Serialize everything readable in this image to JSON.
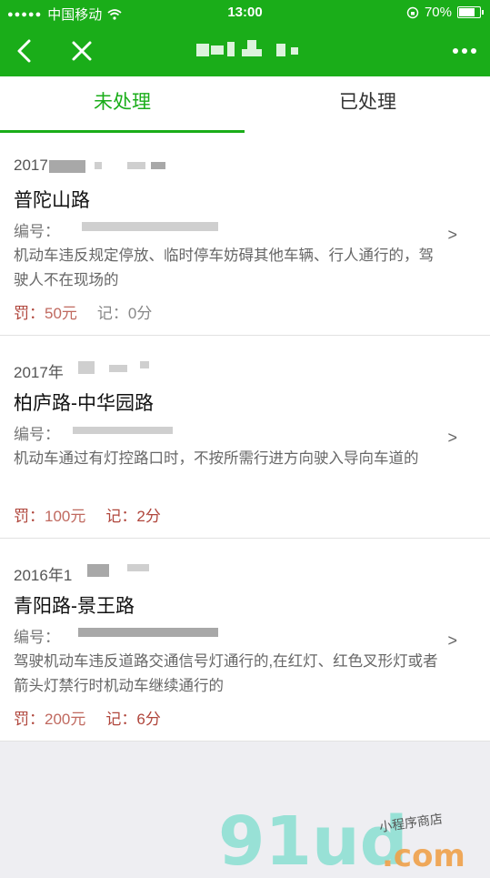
{
  "status_bar": {
    "carrier": "中国移动",
    "time": "13:00",
    "battery": "70%"
  },
  "nav": {
    "title_masked": true
  },
  "tabs": [
    {
      "label": "未处理",
      "active": true
    },
    {
      "label": "已处理",
      "active": false
    }
  ],
  "records": [
    {
      "date": "2017",
      "road": "普陀山路",
      "code_label": "编号：",
      "desc": "机动车违反规定停放、临时停车妨碍其他车辆、行人通行的，驾驶人不在现场的",
      "fine_label": "罚：",
      "fine": "50元",
      "points_label": "记：",
      "points": "0分",
      "arrow": ">"
    },
    {
      "date": "2017年",
      "road": "柏庐路-中华园路",
      "code_label": "编号：",
      "desc": "机动车通过有灯控路口时，不按所需行进方向驶入导向车道的",
      "fine_label": "罚：",
      "fine": "100元",
      "points_label": "记：",
      "points": "2分",
      "arrow": ">"
    },
    {
      "date": "2016年1",
      "road": "青阳路-景王路",
      "code_label": "编号：",
      "desc": "驾驶机动车违反道路交通信号灯通行的,在红灯、红色叉形灯或者箭头灯禁行时机动车继续通行的",
      "fine_label": "罚：",
      "fine": "200元",
      "points_label": "记：",
      "points": "6分",
      "arrow": ">"
    }
  ],
  "watermark": {
    "brand": "91ud",
    "domain": ".com",
    "tagline": "小程序商店"
  },
  "colors": {
    "accent": "#1aad19",
    "fine": "#b0463c"
  }
}
